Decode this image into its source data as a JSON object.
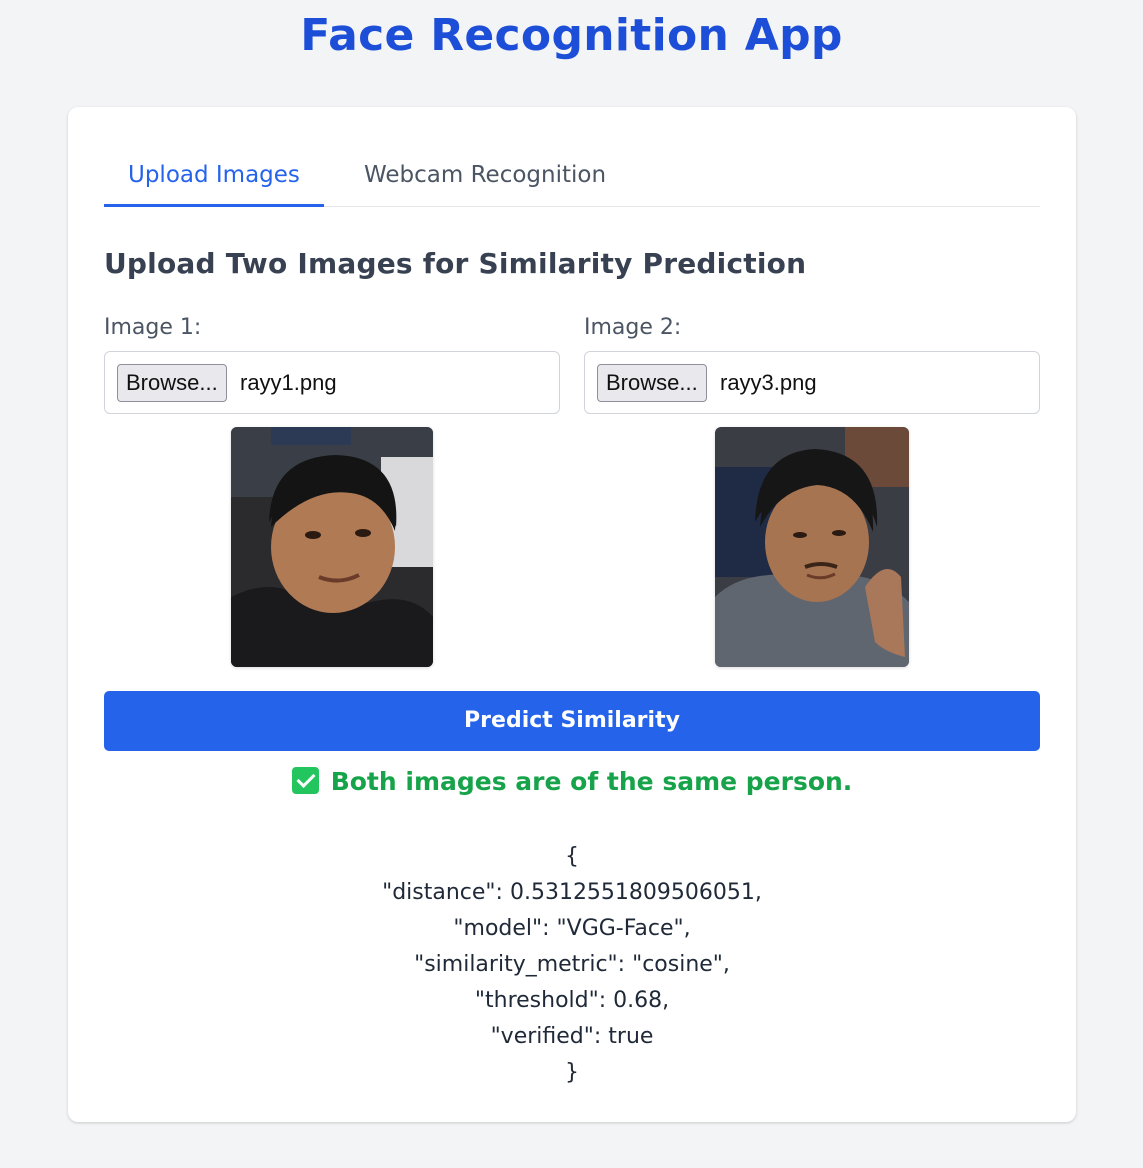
{
  "app": {
    "title": "Face Recognition App"
  },
  "tabs": [
    {
      "label": "Upload Images",
      "active": true
    },
    {
      "label": "Webcam Recognition",
      "active": false
    }
  ],
  "section": {
    "title": "Upload Two Images for Similarity Prediction"
  },
  "image1": {
    "label": "Image 1:",
    "browse_label": "Browse...",
    "file_name": "rayy1.png"
  },
  "image2": {
    "label": "Image 2:",
    "browse_label": "Browse...",
    "file_name": "rayy3.png"
  },
  "predict_button": {
    "label": "Predict Similarity"
  },
  "result": {
    "message": "Both images are of the same person.",
    "icon": "check-box-icon",
    "color": "#16a34a"
  },
  "json_output": {
    "open": "{",
    "lines": [
      "\"distance\": 0.5312551809506051,",
      "\"model\": \"VGG-Face\",",
      "\"similarity_metric\": \"cosine\",",
      "\"threshold\": 0.68,",
      "\"verified\": true"
    ],
    "close": "}"
  },
  "colors": {
    "accent": "#2563eb",
    "title": "#1d4ed8",
    "success": "#16a34a",
    "background": "#f3f4f6"
  }
}
